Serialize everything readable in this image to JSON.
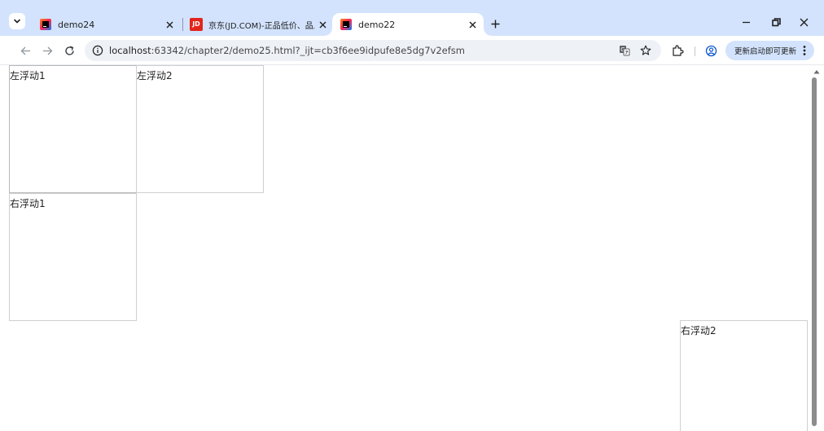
{
  "browser": {
    "tabs": [
      {
        "title": "demo24",
        "favicon": "intellij-icon"
      },
      {
        "title": "京东(JD.COM)-正品低价、品质",
        "favicon": "jd-icon",
        "favicon_text": "JD"
      },
      {
        "title": "demo22",
        "favicon": "intellij-icon",
        "active": true
      }
    ],
    "url": {
      "host": "localhost",
      "rest": ":63342/chapter2/demo25.html?_ijt=cb3f6ee9idpufe8e5dg7v2efsm"
    },
    "update_button": "更新启动即可更新",
    "icons": [
      "chevron-down-icon",
      "close-icon",
      "plus-icon",
      "minimize-icon",
      "restore-icon",
      "back-icon",
      "forward-icon",
      "reload-icon",
      "info-icon",
      "translate-icon",
      "star-icon",
      "extensions-icon",
      "profile-icon",
      "menu-dots-icon"
    ],
    "colors": {
      "tabstrip": "#d3e3fd",
      "omnibox": "#eef1f6",
      "jd_red": "#e1251b"
    }
  },
  "page": {
    "boxes": {
      "left1": "左浮动1",
      "left2": "左浮动2",
      "right1": "右浮动1",
      "right2": "右浮动2"
    }
  }
}
